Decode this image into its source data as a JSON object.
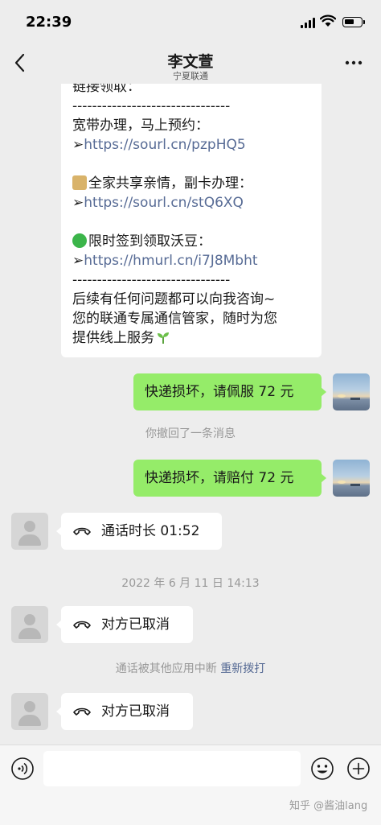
{
  "status_bar": {
    "time": "22:39"
  },
  "nav": {
    "title": "李文萱",
    "subtitle": "宁夏联通"
  },
  "chat": {
    "long_message": {
      "line1": "链接领取：",
      "divider1": "--------------------------------",
      "line2": "宽带办理，马上预约：",
      "link1_prefix": "➢",
      "link1": "https://sourl.cn/pzpHQ5",
      "line3": "全家共享亲情，副卡办理：",
      "link2_prefix": "➢",
      "link2": "https://sourl.cn/stQ6XQ",
      "line4": "限时签到领取沃豆：",
      "link3_prefix": "➢",
      "link3": "https://hmurl.cn/i7J8Mbht",
      "divider2": "--------------------------------",
      "line5": "后续有任何问题都可以向我咨询~",
      "line6": "您的联通专属通信管家，随时为您",
      "line7": "提供线上服务"
    },
    "out_message_1": "快递损坏，请佩服 72 元",
    "recall_notice": "你撤回了一条消息",
    "out_message_2": "快递损坏，请赔付 72 元",
    "call_1": "通话时长 01:52",
    "timestamp": "2022 年 6 月 11 日 14:13",
    "call_2": "对方已取消",
    "interrupted_notice": "通话被其他应用中断",
    "redial_link": "重新拨打",
    "call_3": "对方已取消"
  },
  "input_bar": {
    "placeholder": ""
  },
  "watermark": "知乎 @酱油lang",
  "colors": {
    "bubble_out": "#95ec69",
    "link": "#576b95",
    "background": "#ededed"
  },
  "icons": [
    "back-icon",
    "more-icon",
    "voice-icon",
    "emoji-icon",
    "plus-icon",
    "call-icon"
  ]
}
